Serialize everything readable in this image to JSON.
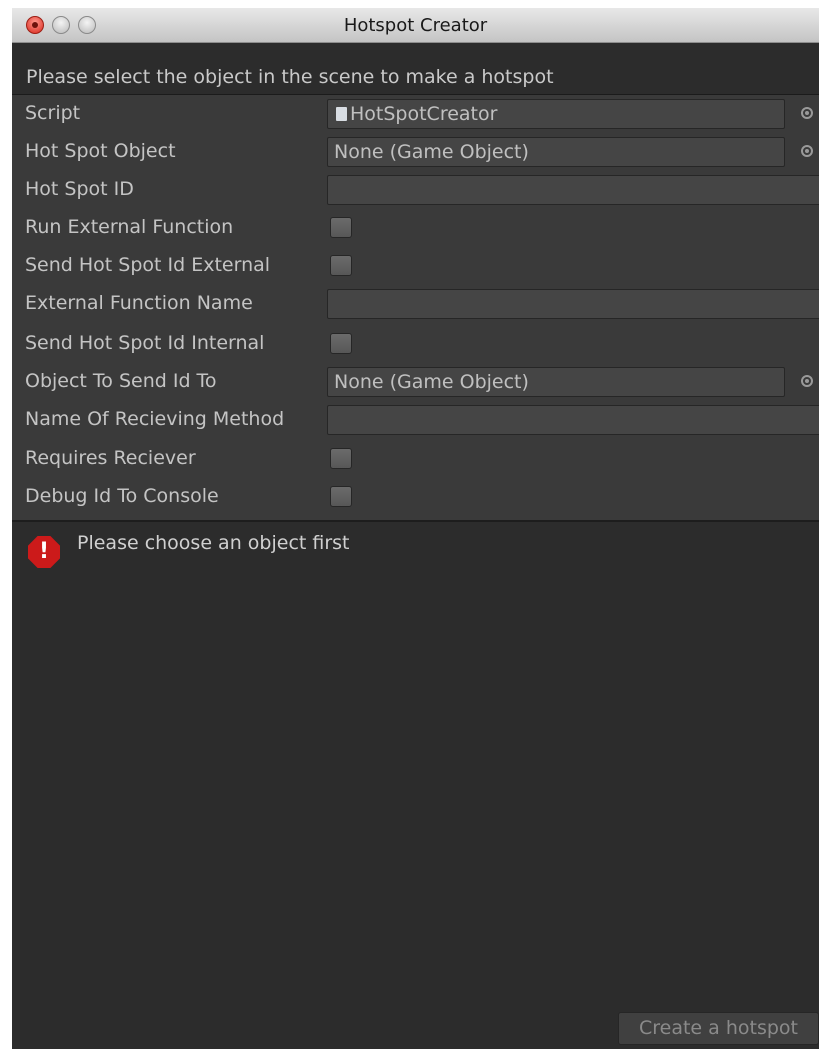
{
  "window": {
    "title": "Hotspot Creator"
  },
  "hint": "Please select the object in the scene to make a hotspot",
  "fields": {
    "script": {
      "label": "Script",
      "value": "HotSpotCreator"
    },
    "hot_spot_object": {
      "label": "Hot Spot Object",
      "value": "None (Game Object)"
    },
    "hot_spot_id": {
      "label": "Hot Spot ID",
      "value": ""
    },
    "run_external_function": {
      "label": "Run External Function",
      "checked": false
    },
    "send_hot_spot_id_external": {
      "label": "Send Hot Spot Id External",
      "checked": false
    },
    "external_function_name": {
      "label": "External Function Name",
      "value": ""
    },
    "send_hot_spot_id_internal": {
      "label": "Send Hot Spot Id Internal",
      "checked": false
    },
    "object_to_send_id_to": {
      "label": "Object To Send Id To",
      "value": "None (Game Object)"
    },
    "name_of_recieving_method": {
      "label": "Name Of Recieving Method",
      "value": ""
    },
    "requires_reciever": {
      "label": "Requires Reciever",
      "checked": false
    },
    "debug_id_to_console": {
      "label": "Debug Id To Console",
      "checked": false
    }
  },
  "help": {
    "icon": "error-icon",
    "message": "Please choose an object first"
  },
  "create_button": {
    "label": "Create a hotspot",
    "enabled": false
  }
}
